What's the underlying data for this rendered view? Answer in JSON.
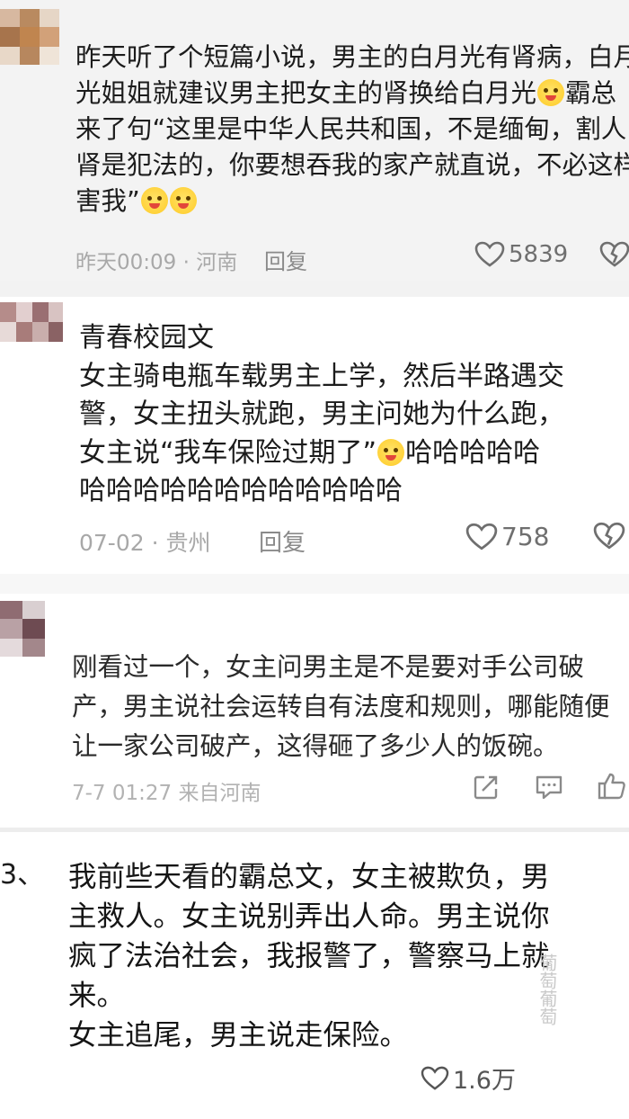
{
  "c1": {
    "lines": [
      "昨天听了个短篇小说，男主的白月光有肾病，白月",
      "光姐姐就建议男主把女主的肾换给白月光",
      "来了句“这里是中华人民共和国，不是缅甸，割人",
      "肾是犯法的，你要想吞我的家产就直说，不必这样",
      "害我”"
    ],
    "line2_tail": "霸总",
    "meta": "昨天00:09 · 河南",
    "reply": "回复",
    "likes": "5839"
  },
  "c2": {
    "lines": [
      "青春校园文",
      "女主骑电瓶车载男主上学，然后半路遇交",
      "警，女主扭头就跑，男主问她为什么跑，",
      "女主说“我车保险过期了”",
      "哈哈哈哈哈哈哈哈哈哈哈哈"
    ],
    "line4_tail": "哈哈哈哈哈",
    "meta": "07-02 · 贵州",
    "reply": "回复",
    "likes": "758"
  },
  "c3": {
    "lines": [
      "刚看过一个，女主问男主是不是要对手公司破",
      "产，男主说社会运转自有法度和规则，哪能随便",
      "让一家公司破产，这得砸了多少人的饭碗。"
    ],
    "meta": "7-7 01:27 来自河南"
  },
  "c4": {
    "number": "3、",
    "lines": [
      "我前些天看的霸总文，女主被欺负，男",
      "主救人。女主说别弄出人命。男主说你",
      "疯了法治社会，我报警了，警察马上就",
      "来。",
      "女主追尾，男主说走保险。"
    ],
    "likes": "1.6万",
    "watermark": "葡萄葡萄"
  },
  "icons": [
    "heart-icon",
    "dislike-icon",
    "share-icon",
    "comment-icon",
    "thumb-up-icon"
  ]
}
